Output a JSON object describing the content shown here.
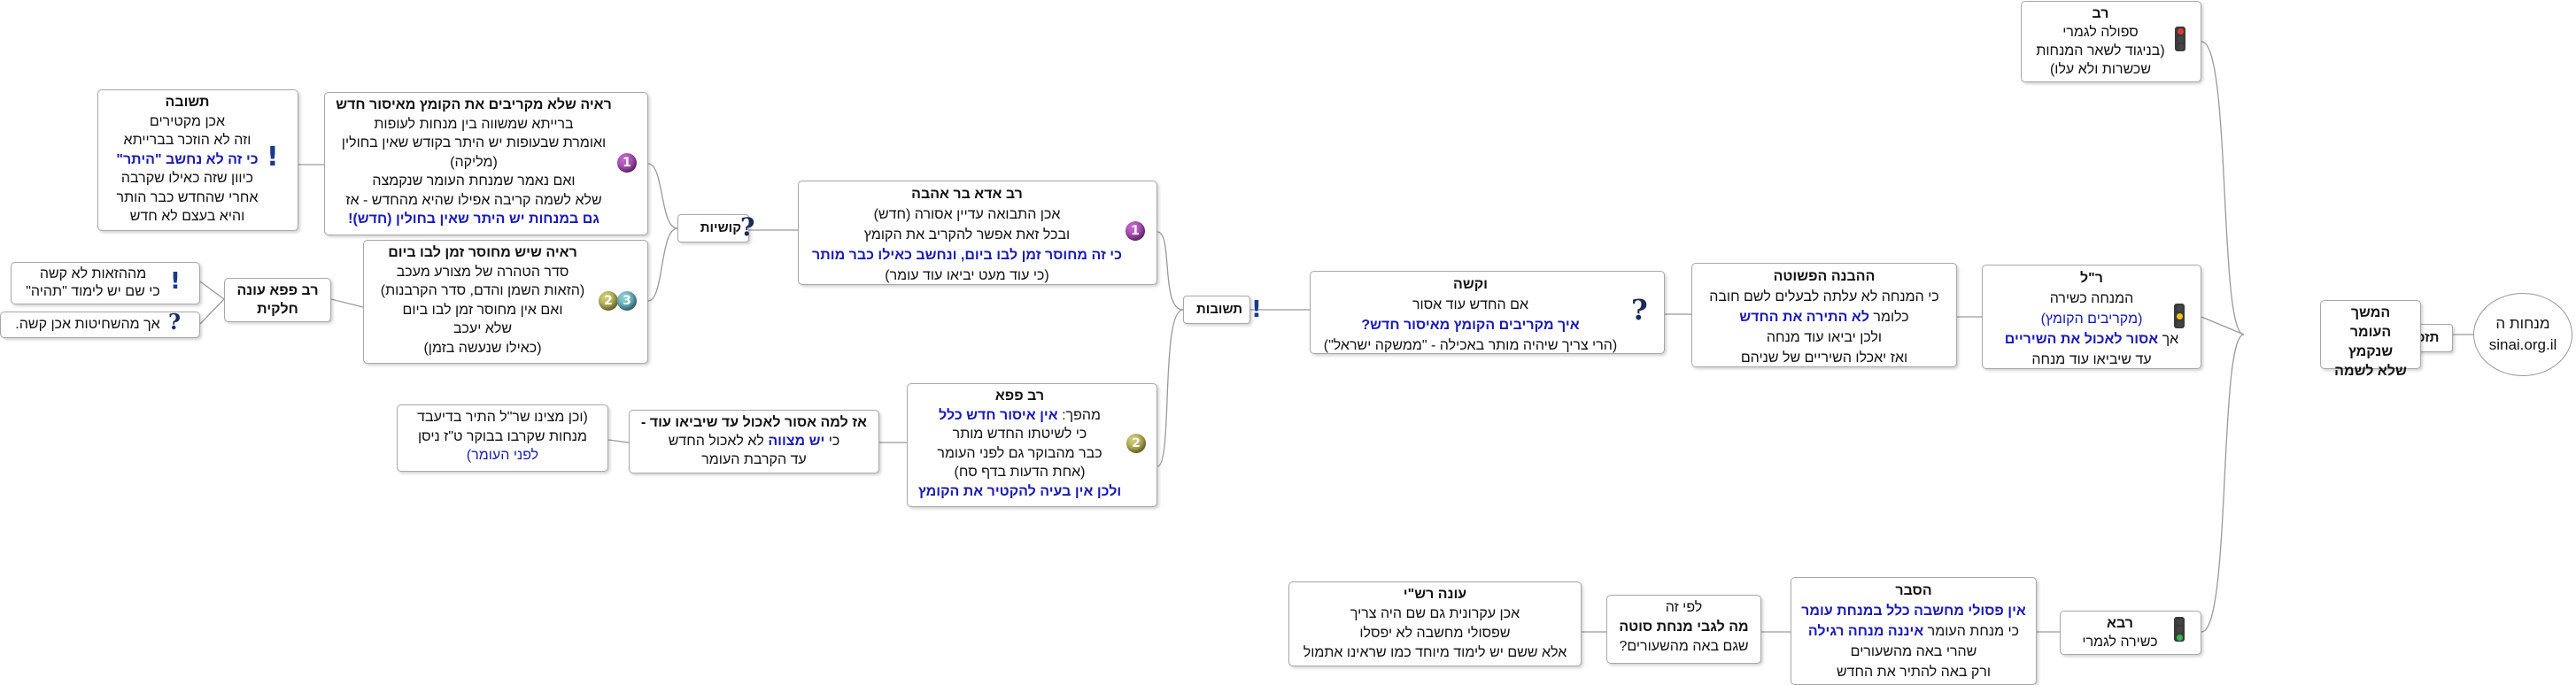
{
  "root": {
    "line1": "מנחות ה",
    "line2": "sinai.org.il"
  },
  "tizkorot": {
    "label": "תזכורות"
  },
  "hamashach": {
    "lines": [
      "המשך",
      "העומר שנקמץ",
      "שלא לשמה"
    ]
  },
  "rav": {
    "title": "רב",
    "lines": [
      "ספולה לגמרי",
      "(בניגוד לשאר המנחות",
      "שכשרות ולא עלו)"
    ]
  },
  "ril": {
    "title": "ר\"ל",
    "lines": [
      "המנחה כשירה",
      "(מקריבים הקומץ)"
    ],
    "line3a": "אך ",
    "line3b": "אסור לאכול את השיריים",
    "line4": "עד שיביאו עוד מנחה"
  },
  "havana": {
    "title": "ההבנה הפשוטה",
    "line1": "כי המנחה לא עלתה לבעלים לשם חובה",
    "line2a": "כלומר ",
    "line2b": "לא התירה את החדש",
    "line3": "ולכן יביאו עוד מנחה",
    "line4": "ואז יאכלו השיריים של שניהם"
  },
  "kusha": {
    "title": "וקשה",
    "line1": "אם החדש עוד אסור",
    "line2": "איך מקריבים הקומץ מאיסור חדש?",
    "line3": "(הרי צריך שיהיה מותר באכילה - \"ממשקה ישראל\")"
  },
  "teshuvot": {
    "label": "תשובות"
  },
  "adda": {
    "title": "רב אדא בר אהבה",
    "line1": "אכן התבואה עדיין אסורה (חדש)",
    "line2": "ובכל זאת אפשר להקריב את הקומץ",
    "line3": "כי זה מחוסר זמן לבו ביום, ונחשב כאילו כבר מותר",
    "line4": "(כי עוד מעט יביאו עוד עומר)"
  },
  "kushyot": {
    "label": "קושיות"
  },
  "raaya1": {
    "title": "ראיה שלא מקריבים את הקומץ מאיסור חדש",
    "line1": "ברייתא שמשווה בין מנחות לעופות",
    "line2": "ואומרת שבעופות יש היתר בקודש שאין בחולין",
    "line3": "(מליקה)",
    "line4": "ואם נאמר שמנחת העומר שנקמצה",
    "line5": "שלא לשמה קריבה אפילו שהיא מהחדש - אז",
    "line6": "גם במנחות יש היתר שאין בחולין (חדש)!"
  },
  "teshuva1": {
    "title": "תשובה",
    "line1": "אכן מקטירים",
    "line2": "וזה לא הוזכר בברייתא",
    "line3": "כי זה לא נחשב \"היתר\"",
    "line4": "כיוון שזה כאילו שקרבה",
    "line5": "אחרי שהחדש כבר הותר",
    "line6": "והיא בעצם לא חדש"
  },
  "raaya2": {
    "title": "ראיה שיש מחוסר זמן לבו ביום",
    "line1": "סדר הטהרה של מצורע מעכב",
    "line2": "(הזאות השמן והדם, סדר הקרבנות)",
    "line3": "ואם אין מחוסר זמן לבו ביום",
    "line4": "שלא יעכב",
    "line5": "(כאילו שנעשה בזמן)"
  },
  "papaAnswer": {
    "lines": [
      "רב פפא עונה",
      "חלקית"
    ]
  },
  "mehahazaot": {
    "text": "מההזאות לא קשה",
    "text2": "כי שם יש לימוד \"תהיה\""
  },
  "mehashechitot": {
    "text": "אך מהשחיטות אכן קשה."
  },
  "papa": {
    "title": "רב פפא",
    "line1a": "מהפך: ",
    "line1b": "אין איסור חדש כלל",
    "line2": "כי לשיטתו החדש מותר",
    "line3": "כבר מהבוקר גם לפני העומר",
    "line4": "(אחת הדעות בדף סח)",
    "line5": "ולכן אין בעיה להקטיר את הקומץ"
  },
  "az": {
    "title": "אז למה אסור לאכול עד שיביאו עוד -",
    "line1a": "כי ",
    "line1b": "יש מצווה",
    "line1c": " לא לאכול החדש",
    "line2": "עד הקרבת העומר"
  },
  "vechen": {
    "line1": "(וכן מצינו שר\"ל התיר בדיעבד",
    "line2": "מנחות שקרבו בבוקר ט\"ז ניסן",
    "line3": "לפני העומר)"
  },
  "rava": {
    "title": "רבא",
    "line1": "כשירה לגמרי"
  },
  "hesber": {
    "title": "הסבר",
    "line1": "אין פסולי מחשבה כלל במנחת עומר",
    "line2a": "כי מנחת העומר  ",
    "line2b": "איננה מנחה רגילה",
    "line3": "שהרי באה מהשעורים",
    "line4": "ורק באה להתיר את החדש"
  },
  "lefi": {
    "line1": "לפי זה",
    "line2": "מה לגבי מנחת סוטה",
    "line3": "שגם באה מהשעורים?"
  },
  "rashi": {
    "title": "עונה רש\"י",
    "line1": "אכן עקרונית גם שם היה צריך",
    "line2": "שפסולי מחשבה לא יפסלו",
    "line3": "אלא ששם יש לימוד מיוחד כמו שראינו אתמול"
  },
  "colors": {
    "link": "#9a9a9a",
    "blueText": "#1a1ab5",
    "border": "#a8a8a8",
    "questionIcon": "#1b2b58"
  }
}
